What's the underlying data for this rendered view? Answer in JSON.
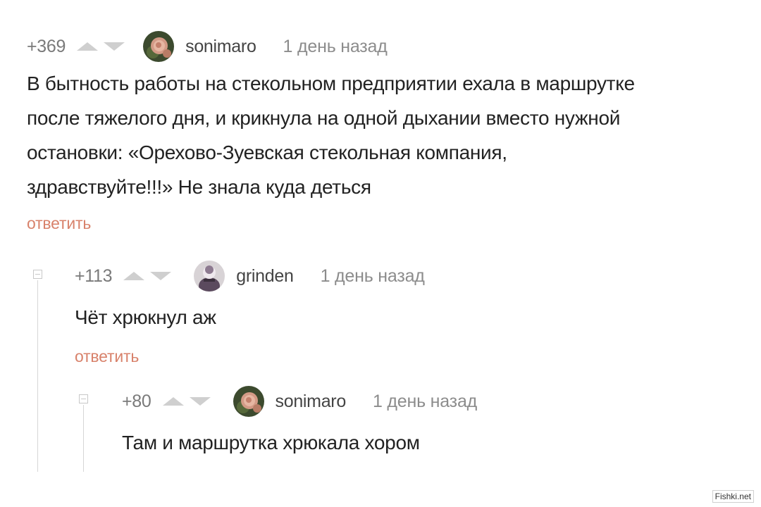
{
  "comments": [
    {
      "rating": "+369",
      "username": "sonimaro",
      "time": "1 день назад",
      "avatar_icon": "rose-avatar-icon",
      "body_lines": [
        "В бытность работы на стекольном предприятии ехала в маршрутке",
        "после тяжелого дня, и крикнула на одной дыхании вместо нужной",
        "остановки: «Орехово-Зуевская стекольная компания,",
        "здравствуйте!!!» Не знала куда деться"
      ],
      "reply_label": "ответить"
    },
    {
      "rating": "+113",
      "username": "grinden",
      "time": "1 день назад",
      "avatar_icon": "figure-avatar-icon",
      "body_lines": [
        "Чёт хрюкнул аж"
      ],
      "reply_label": "ответить"
    },
    {
      "rating": "+80",
      "username": "sonimaro",
      "time": "1 день назад",
      "avatar_icon": "rose-avatar-icon",
      "body_lines": [
        "Там и маршрутка хрюкала хором"
      ]
    }
  ],
  "watermark": "Fishki.net",
  "colors": {
    "reply": "#d8826b",
    "rating": "#7a7a7a",
    "vote_arrow": "#cfcfcf",
    "time": "#8c8c8c"
  }
}
